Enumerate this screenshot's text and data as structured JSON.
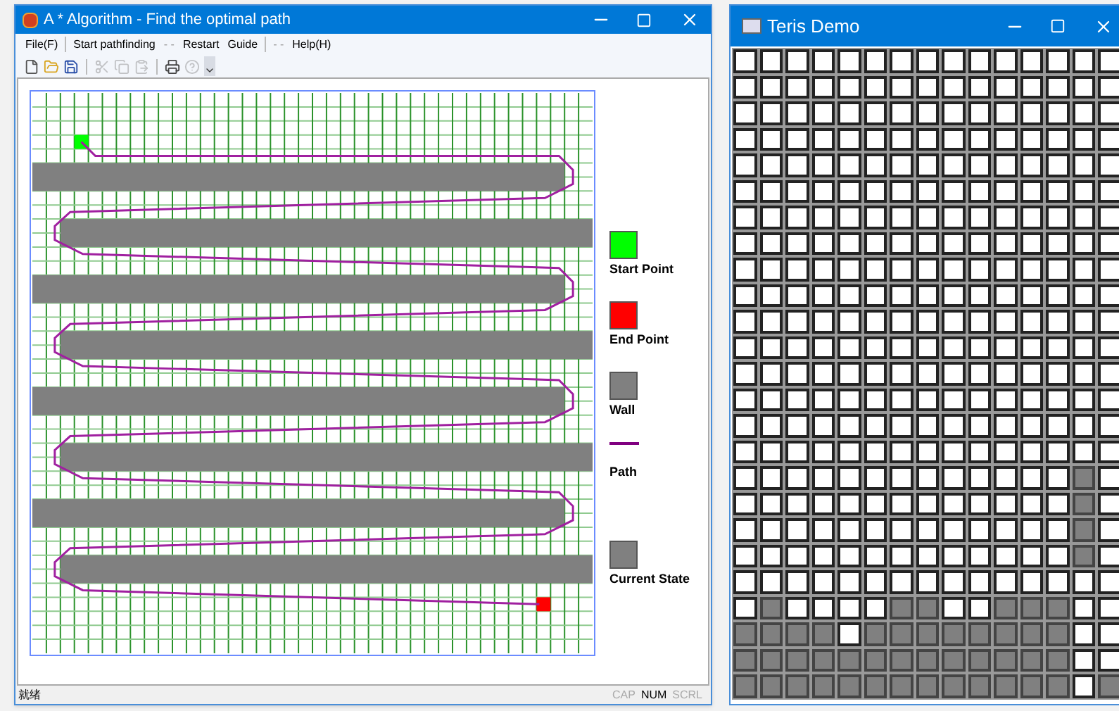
{
  "astar_window": {
    "title": "A * Algorithm - Find the optimal path",
    "menu": [
      {
        "kind": "item",
        "label": "File(F)",
        "disabled": false
      },
      {
        "kind": "separator"
      },
      {
        "kind": "item",
        "label": "Start pathfinding",
        "disabled": false
      },
      {
        "kind": "item",
        "label": "- -",
        "disabled": true
      },
      {
        "kind": "item",
        "label": "Restart",
        "disabled": false
      },
      {
        "kind": "item",
        "label": "Guide",
        "disabled": false
      },
      {
        "kind": "separator"
      },
      {
        "kind": "item",
        "label": "- -",
        "disabled": true
      },
      {
        "kind": "item",
        "label": "Help(H)",
        "disabled": false
      }
    ],
    "toolbar": [
      {
        "kind": "new",
        "disabled": false
      },
      {
        "kind": "open",
        "disabled": false
      },
      {
        "kind": "save",
        "disabled": false
      },
      {
        "kind": "separator"
      },
      {
        "kind": "cut",
        "disabled": true
      },
      {
        "kind": "copy",
        "disabled": true
      },
      {
        "kind": "paste",
        "disabled": true
      },
      {
        "kind": "separator"
      },
      {
        "kind": "print",
        "disabled": false
      },
      {
        "kind": "about",
        "disabled": true
      }
    ],
    "maze": {
      "rows": [
        {
          "kind": "open"
        },
        {
          "kind": "open"
        },
        {
          "kind": "open"
        },
        {
          "kind": "start_row"
        },
        {
          "kind": "open"
        },
        {
          "kind": "wall_left"
        },
        {
          "kind": "wall_left"
        },
        {
          "kind": "open"
        },
        {
          "kind": "open"
        },
        {
          "kind": "wall_right"
        },
        {
          "kind": "wall_right"
        },
        {
          "kind": "open"
        },
        {
          "kind": "open"
        },
        {
          "kind": "wall_left"
        },
        {
          "kind": "wall_left"
        },
        {
          "kind": "open"
        },
        {
          "kind": "open"
        },
        {
          "kind": "wall_right"
        },
        {
          "kind": "wall_right"
        },
        {
          "kind": "open"
        },
        {
          "kind": "open"
        },
        {
          "kind": "wall_left"
        },
        {
          "kind": "wall_left"
        },
        {
          "kind": "open"
        },
        {
          "kind": "open"
        },
        {
          "kind": "wall_right"
        },
        {
          "kind": "wall_right"
        },
        {
          "kind": "open"
        },
        {
          "kind": "open"
        },
        {
          "kind": "wall_left"
        },
        {
          "kind": "wall_left"
        },
        {
          "kind": "open"
        },
        {
          "kind": "open"
        },
        {
          "kind": "wall_right"
        },
        {
          "kind": "wall_right"
        },
        {
          "kind": "open"
        },
        {
          "kind": "end_row"
        },
        {
          "kind": "open"
        },
        {
          "kind": "open"
        },
        {
          "kind": "open"
        }
      ]
    },
    "legend": [
      {
        "kind": "swatch",
        "label": "Start Point",
        "color": "#00ff00"
      },
      {
        "kind": "swatch",
        "label": "End Point",
        "color": "#ff0000"
      },
      {
        "kind": "swatch",
        "label": "Wall",
        "color": "#808080"
      },
      {
        "kind": "line",
        "label": "Path",
        "color": "#800080"
      },
      {
        "kind": "swatch",
        "label": "Current State",
        "color": "#808080"
      }
    ],
    "status_bar": {
      "text": "就绪",
      "indicators": [
        {
          "label": "CAP",
          "on": false
        },
        {
          "label": "NUM",
          "on": true
        },
        {
          "label": "SCRL",
          "on": false
        }
      ]
    }
  },
  "tetris_window": {
    "title": "Teris Demo",
    "board": [
      [
        false,
        false,
        false,
        false,
        false,
        false,
        false,
        false,
        false,
        false,
        false,
        false,
        false,
        false,
        false
      ],
      [
        false,
        false,
        false,
        false,
        false,
        false,
        false,
        false,
        false,
        false,
        false,
        false,
        false,
        false,
        false
      ],
      [
        false,
        false,
        false,
        false,
        false,
        false,
        false,
        false,
        false,
        false,
        false,
        false,
        false,
        false,
        false
      ],
      [
        false,
        false,
        false,
        false,
        false,
        false,
        false,
        false,
        false,
        false,
        false,
        false,
        false,
        false,
        false
      ],
      [
        false,
        false,
        false,
        false,
        false,
        false,
        false,
        false,
        false,
        false,
        false,
        false,
        false,
        false,
        false
      ],
      [
        false,
        false,
        false,
        false,
        false,
        false,
        false,
        false,
        false,
        false,
        false,
        false,
        false,
        false,
        false
      ],
      [
        false,
        false,
        false,
        false,
        false,
        false,
        false,
        false,
        false,
        false,
        false,
        false,
        false,
        false,
        false
      ],
      [
        false,
        false,
        false,
        false,
        false,
        false,
        false,
        false,
        false,
        false,
        false,
        false,
        false,
        false,
        false
      ],
      [
        false,
        false,
        false,
        false,
        false,
        false,
        false,
        false,
        false,
        false,
        false,
        false,
        false,
        false,
        false
      ],
      [
        false,
        false,
        false,
        false,
        false,
        false,
        false,
        false,
        false,
        false,
        false,
        false,
        false,
        false,
        false
      ],
      [
        false,
        false,
        false,
        false,
        false,
        false,
        false,
        false,
        false,
        false,
        false,
        false,
        false,
        false,
        false
      ],
      [
        false,
        false,
        false,
        false,
        false,
        false,
        false,
        false,
        false,
        false,
        false,
        false,
        false,
        false,
        false
      ],
      [
        false,
        false,
        false,
        false,
        false,
        false,
        false,
        false,
        false,
        false,
        false,
        false,
        false,
        false,
        false
      ],
      [
        false,
        false,
        false,
        false,
        false,
        false,
        false,
        false,
        false,
        false,
        false,
        false,
        false,
        false,
        false
      ],
      [
        false,
        false,
        false,
        false,
        false,
        false,
        false,
        false,
        false,
        false,
        false,
        false,
        false,
        false,
        false
      ],
      [
        false,
        false,
        false,
        false,
        false,
        false,
        false,
        false,
        false,
        false,
        false,
        false,
        false,
        false,
        false
      ],
      [
        false,
        false,
        false,
        false,
        false,
        false,
        false,
        false,
        false,
        false,
        false,
        false,
        false,
        true,
        false
      ],
      [
        false,
        false,
        false,
        false,
        false,
        false,
        false,
        false,
        false,
        false,
        false,
        false,
        false,
        true,
        false
      ],
      [
        false,
        false,
        false,
        false,
        false,
        false,
        false,
        false,
        false,
        false,
        false,
        false,
        false,
        true,
        false
      ],
      [
        false,
        false,
        false,
        false,
        false,
        false,
        false,
        false,
        false,
        false,
        false,
        false,
        false,
        true,
        false
      ],
      [
        false,
        false,
        false,
        false,
        false,
        false,
        false,
        false,
        false,
        false,
        false,
        false,
        false,
        false,
        false
      ],
      [
        false,
        true,
        false,
        false,
        false,
        false,
        true,
        true,
        false,
        false,
        true,
        true,
        true,
        false,
        false
      ],
      [
        true,
        true,
        true,
        true,
        false,
        true,
        true,
        true,
        true,
        true,
        true,
        true,
        true,
        false,
        false
      ],
      [
        true,
        true,
        true,
        true,
        true,
        true,
        true,
        true,
        true,
        true,
        true,
        true,
        true,
        false,
        false
      ],
      [
        true,
        true,
        true,
        true,
        true,
        true,
        true,
        true,
        true,
        true,
        true,
        true,
        true,
        false,
        true
      ]
    ]
  }
}
